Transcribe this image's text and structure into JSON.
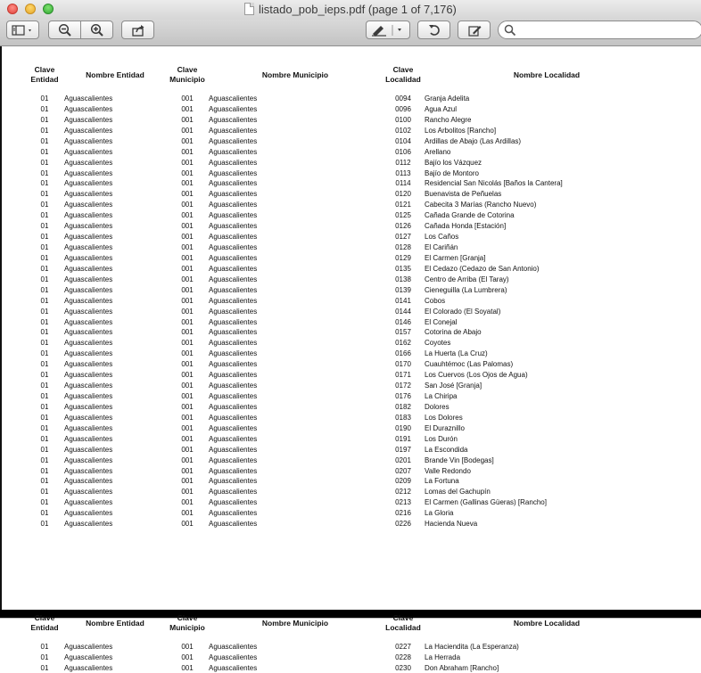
{
  "window": {
    "title": "listado_pob_ieps.pdf (page 1 of 7,176)",
    "icons": [
      "sidebar-toggle-icon",
      "zoom-out-icon",
      "zoom-in-icon",
      "share-icon",
      "annotate-pen-icon",
      "rotate-icon",
      "edit-toolbar-icon",
      "search-icon"
    ]
  },
  "search": {
    "placeholder": ""
  },
  "table": {
    "headers": {
      "clave_entidad": "Clave\nEntidad",
      "nombre_entidad": "Nombre Entidad",
      "clave_municipio": "Clave\nMunicipio",
      "nombre_municipio": "Nombre Municipio",
      "clave_localidad": "Clave\nLocalidad",
      "nombre_localidad": "Nombre Localidad"
    },
    "page1_rows": [
      [
        "01",
        "Aguascalientes",
        "001",
        "Aguascalientes",
        "0094",
        "Granja Adelita"
      ],
      [
        "01",
        "Aguascalientes",
        "001",
        "Aguascalientes",
        "0096",
        "Agua Azul"
      ],
      [
        "01",
        "Aguascalientes",
        "001",
        "Aguascalientes",
        "0100",
        "Rancho Alegre"
      ],
      [
        "01",
        "Aguascalientes",
        "001",
        "Aguascalientes",
        "0102",
        "Los Arbolitos [Rancho]"
      ],
      [
        "01",
        "Aguascalientes",
        "001",
        "Aguascalientes",
        "0104",
        "Ardillas de Abajo (Las Ardillas)"
      ],
      [
        "01",
        "Aguascalientes",
        "001",
        "Aguascalientes",
        "0106",
        "Arellano"
      ],
      [
        "01",
        "Aguascalientes",
        "001",
        "Aguascalientes",
        "0112",
        "Bajío los Vázquez"
      ],
      [
        "01",
        "Aguascalientes",
        "001",
        "Aguascalientes",
        "0113",
        "Bajío de Montoro"
      ],
      [
        "01",
        "Aguascalientes",
        "001",
        "Aguascalientes",
        "0114",
        "Residencial San Nicolás [Baños la Cantera]"
      ],
      [
        "01",
        "Aguascalientes",
        "001",
        "Aguascalientes",
        "0120",
        "Buenavista de Peñuelas"
      ],
      [
        "01",
        "Aguascalientes",
        "001",
        "Aguascalientes",
        "0121",
        "Cabecita 3 Marías (Rancho Nuevo)"
      ],
      [
        "01",
        "Aguascalientes",
        "001",
        "Aguascalientes",
        "0125",
        "Cañada Grande de Cotorina"
      ],
      [
        "01",
        "Aguascalientes",
        "001",
        "Aguascalientes",
        "0126",
        "Cañada Honda [Estación]"
      ],
      [
        "01",
        "Aguascalientes",
        "001",
        "Aguascalientes",
        "0127",
        "Los Caños"
      ],
      [
        "01",
        "Aguascalientes",
        "001",
        "Aguascalientes",
        "0128",
        "El Cariñán"
      ],
      [
        "01",
        "Aguascalientes",
        "001",
        "Aguascalientes",
        "0129",
        "El Carmen [Granja]"
      ],
      [
        "01",
        "Aguascalientes",
        "001",
        "Aguascalientes",
        "0135",
        "El Cedazo (Cedazo de San Antonio)"
      ],
      [
        "01",
        "Aguascalientes",
        "001",
        "Aguascalientes",
        "0138",
        "Centro de Arriba (El Taray)"
      ],
      [
        "01",
        "Aguascalientes",
        "001",
        "Aguascalientes",
        "0139",
        "Cieneguilla (La Lumbrera)"
      ],
      [
        "01",
        "Aguascalientes",
        "001",
        "Aguascalientes",
        "0141",
        "Cobos"
      ],
      [
        "01",
        "Aguascalientes",
        "001",
        "Aguascalientes",
        "0144",
        "El Colorado (El Soyatal)"
      ],
      [
        "01",
        "Aguascalientes",
        "001",
        "Aguascalientes",
        "0146",
        "El Conejal"
      ],
      [
        "01",
        "Aguascalientes",
        "001",
        "Aguascalientes",
        "0157",
        "Cotorina de Abajo"
      ],
      [
        "01",
        "Aguascalientes",
        "001",
        "Aguascalientes",
        "0162",
        "Coyotes"
      ],
      [
        "01",
        "Aguascalientes",
        "001",
        "Aguascalientes",
        "0166",
        "La Huerta (La Cruz)"
      ],
      [
        "01",
        "Aguascalientes",
        "001",
        "Aguascalientes",
        "0170",
        "Cuauhtémoc (Las Palomas)"
      ],
      [
        "01",
        "Aguascalientes",
        "001",
        "Aguascalientes",
        "0171",
        "Los Cuervos (Los Ojos de Agua)"
      ],
      [
        "01",
        "Aguascalientes",
        "001",
        "Aguascalientes",
        "0172",
        "San José [Granja]"
      ],
      [
        "01",
        "Aguascalientes",
        "001",
        "Aguascalientes",
        "0176",
        "La Chiripa"
      ],
      [
        "01",
        "Aguascalientes",
        "001",
        "Aguascalientes",
        "0182",
        "Dolores"
      ],
      [
        "01",
        "Aguascalientes",
        "001",
        "Aguascalientes",
        "0183",
        "Los Dolores"
      ],
      [
        "01",
        "Aguascalientes",
        "001",
        "Aguascalientes",
        "0190",
        "El Duraznillo"
      ],
      [
        "01",
        "Aguascalientes",
        "001",
        "Aguascalientes",
        "0191",
        "Los Durón"
      ],
      [
        "01",
        "Aguascalientes",
        "001",
        "Aguascalientes",
        "0197",
        "La Escondida"
      ],
      [
        "01",
        "Aguascalientes",
        "001",
        "Aguascalientes",
        "0201",
        "Brande Vin [Bodegas]"
      ],
      [
        "01",
        "Aguascalientes",
        "001",
        "Aguascalientes",
        "0207",
        "Valle Redondo"
      ],
      [
        "01",
        "Aguascalientes",
        "001",
        "Aguascalientes",
        "0209",
        "La Fortuna"
      ],
      [
        "01",
        "Aguascalientes",
        "001",
        "Aguascalientes",
        "0212",
        "Lomas del Gachupín"
      ],
      [
        "01",
        "Aguascalientes",
        "001",
        "Aguascalientes",
        "0213",
        "El Carmen (Gallinas Güeras) [Rancho]"
      ],
      [
        "01",
        "Aguascalientes",
        "001",
        "Aguascalientes",
        "0216",
        "La Gloria"
      ],
      [
        "01",
        "Aguascalientes",
        "001",
        "Aguascalientes",
        "0226",
        "Hacienda Nueva"
      ]
    ],
    "page2_rows": [
      [
        "01",
        "Aguascalientes",
        "001",
        "Aguascalientes",
        "0227",
        "La Haciendita (La Esperanza)"
      ],
      [
        "01",
        "Aguascalientes",
        "001",
        "Aguascalientes",
        "0228",
        "La Herrada"
      ],
      [
        "01",
        "Aguascalientes",
        "001",
        "Aguascalientes",
        "0230",
        "Don Abraham [Rancho]"
      ]
    ]
  }
}
